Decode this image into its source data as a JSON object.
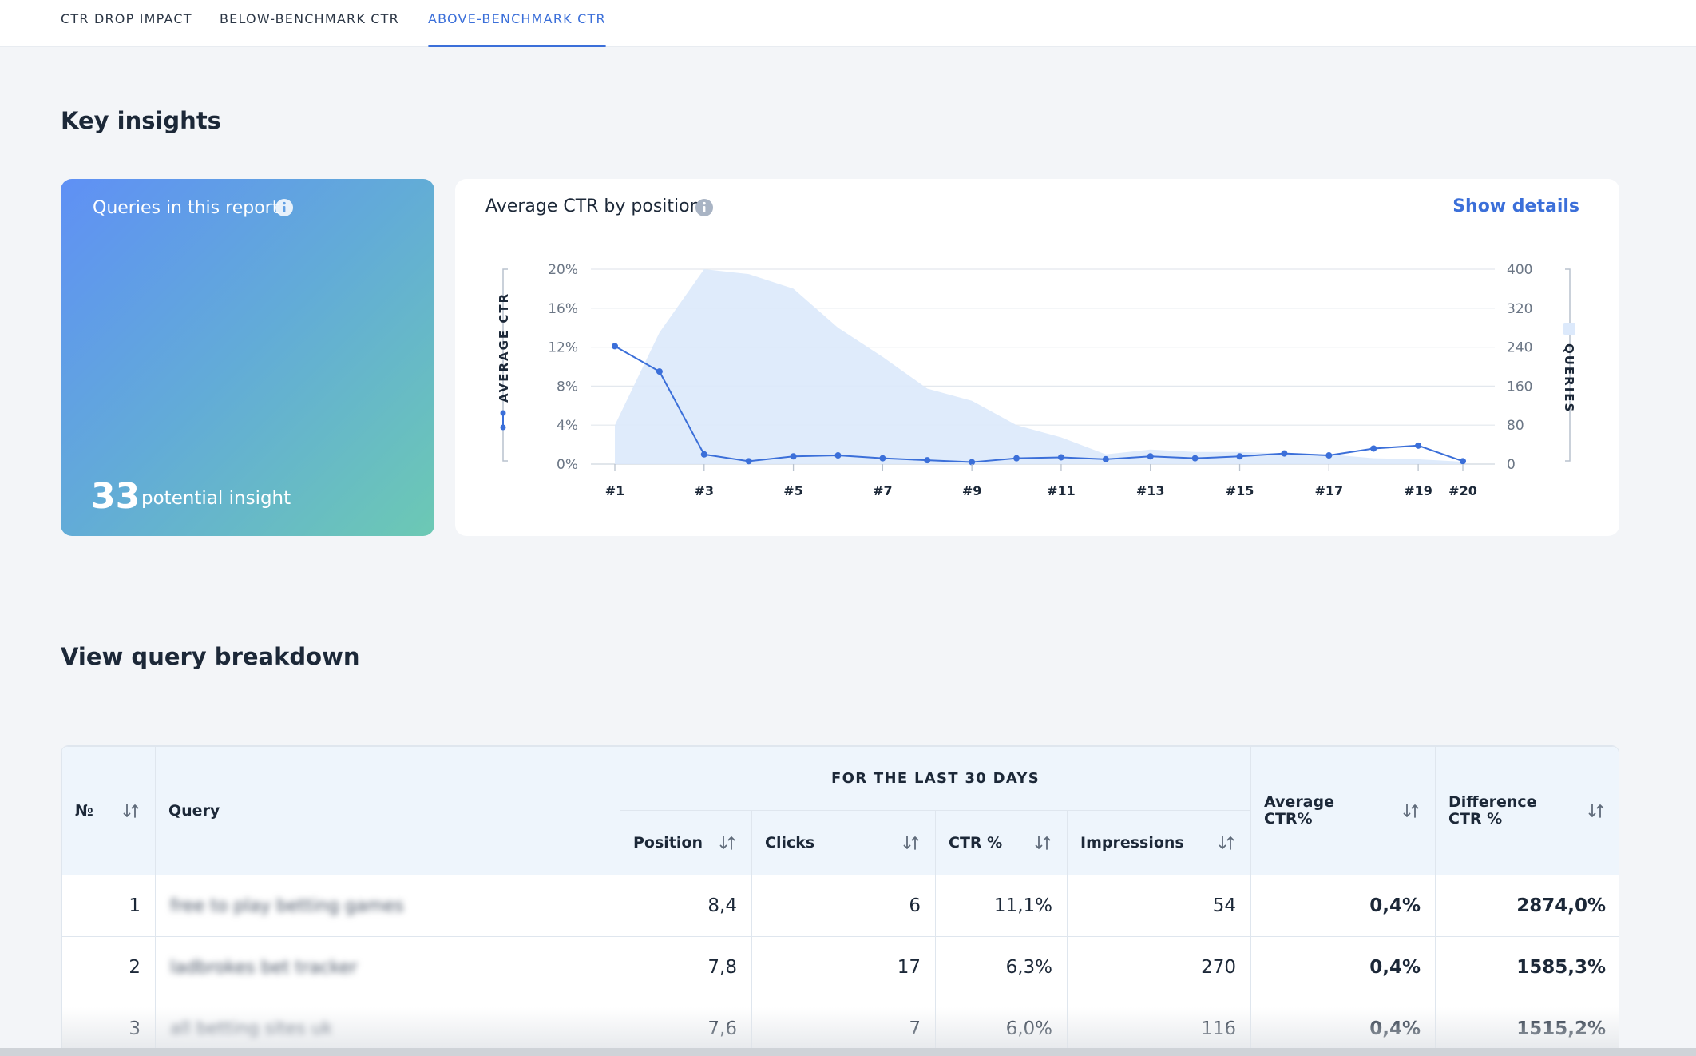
{
  "tabs": [
    {
      "label": "CTR DROP IMPACT",
      "active": false
    },
    {
      "label": "BELOW-BENCHMARK CTR",
      "active": false
    },
    {
      "label": "ABOVE-BENCHMARK CTR",
      "active": true
    }
  ],
  "key_insights": {
    "title": "Key insights",
    "queries_card": {
      "title": "Queries in this report",
      "count": "33",
      "count_label": "potential insight"
    },
    "chart_card": {
      "title": "Average CTR by position",
      "details_link": "Show details"
    }
  },
  "breakdown": {
    "title": "View query breakdown",
    "columns": {
      "no": "№",
      "query": "Query",
      "group": "FOR THE LAST 30 DAYS",
      "position": "Position",
      "clicks": "Clicks",
      "ctr": "CTR %",
      "impressions": "Impressions",
      "avg_ctr_1": "Average",
      "avg_ctr_2": "CTR%",
      "diff_ctr_1": "Difference",
      "diff_ctr_2": "CTR %"
    },
    "rows": [
      {
        "no": "1",
        "query": "free to play betting games",
        "position": "8,4",
        "clicks": "6",
        "ctr": "11,1%",
        "impressions": "54",
        "avg_ctr": "0,4%",
        "diff_ctr": "2874,0%"
      },
      {
        "no": "2",
        "query": "ladbrokes bet tracker",
        "position": "7,8",
        "clicks": "17",
        "ctr": "6,3%",
        "impressions": "270",
        "avg_ctr": "0,4%",
        "diff_ctr": "1585,3%"
      },
      {
        "no": "3",
        "query": "all betting sites uk",
        "position": "7,6",
        "clicks": "7",
        "ctr": "6,0%",
        "impressions": "116",
        "avg_ctr": "0,4%",
        "diff_ctr": "1515,2%"
      }
    ]
  },
  "colors": {
    "accent": "#3b6fd9",
    "line": "#3b6fd9",
    "area": "#dce9fb",
    "gradient_start": "#5f90f5",
    "gradient_end": "#6cc9b4"
  },
  "chart_data": {
    "type": "line",
    "title": "Average CTR by position",
    "y_left_label": "AVERAGE CTR",
    "y_right_label": "QUERIES",
    "y_left_ticks": [
      "20%",
      "16%",
      "12%",
      "8%",
      "4%",
      "0%"
    ],
    "y_right_ticks": [
      "400",
      "320",
      "240",
      "160",
      "80",
      "0"
    ],
    "y_left_lim": [
      0,
      20
    ],
    "y_right_lim": [
      0,
      400
    ],
    "x_tick_labels": [
      "#1",
      "#3",
      "#5",
      "#7",
      "#9",
      "#11",
      "#13",
      "#15",
      "#17",
      "#19",
      "#20"
    ],
    "x_tick_positions": [
      1,
      3,
      5,
      7,
      9,
      11,
      13,
      15,
      17,
      19,
      20
    ],
    "grid": true,
    "series": [
      {
        "name": "AVERAGE CTR",
        "kind": "line",
        "axis": "left",
        "x": [
          1,
          2,
          3,
          4,
          5,
          6,
          7,
          8,
          9,
          10,
          11,
          12,
          13,
          14,
          15,
          16,
          17,
          18,
          19,
          20
        ],
        "values": [
          12.1,
          9.5,
          1.0,
          0.3,
          0.8,
          0.9,
          0.6,
          0.4,
          0.2,
          0.6,
          0.7,
          0.5,
          0.8,
          0.6,
          0.8,
          1.1,
          0.9,
          1.6,
          1.9,
          0.3
        ]
      },
      {
        "name": "QUERIES",
        "kind": "area",
        "axis": "right",
        "x": [
          1,
          2,
          3,
          4,
          5,
          6,
          7,
          8,
          9,
          10,
          11,
          12,
          13,
          14,
          15,
          16,
          17,
          18,
          19,
          20
        ],
        "values": [
          80,
          270,
          400,
          390,
          360,
          280,
          220,
          155,
          130,
          80,
          55,
          20,
          30,
          25,
          25,
          22,
          20,
          12,
          10,
          5
        ]
      }
    ]
  }
}
